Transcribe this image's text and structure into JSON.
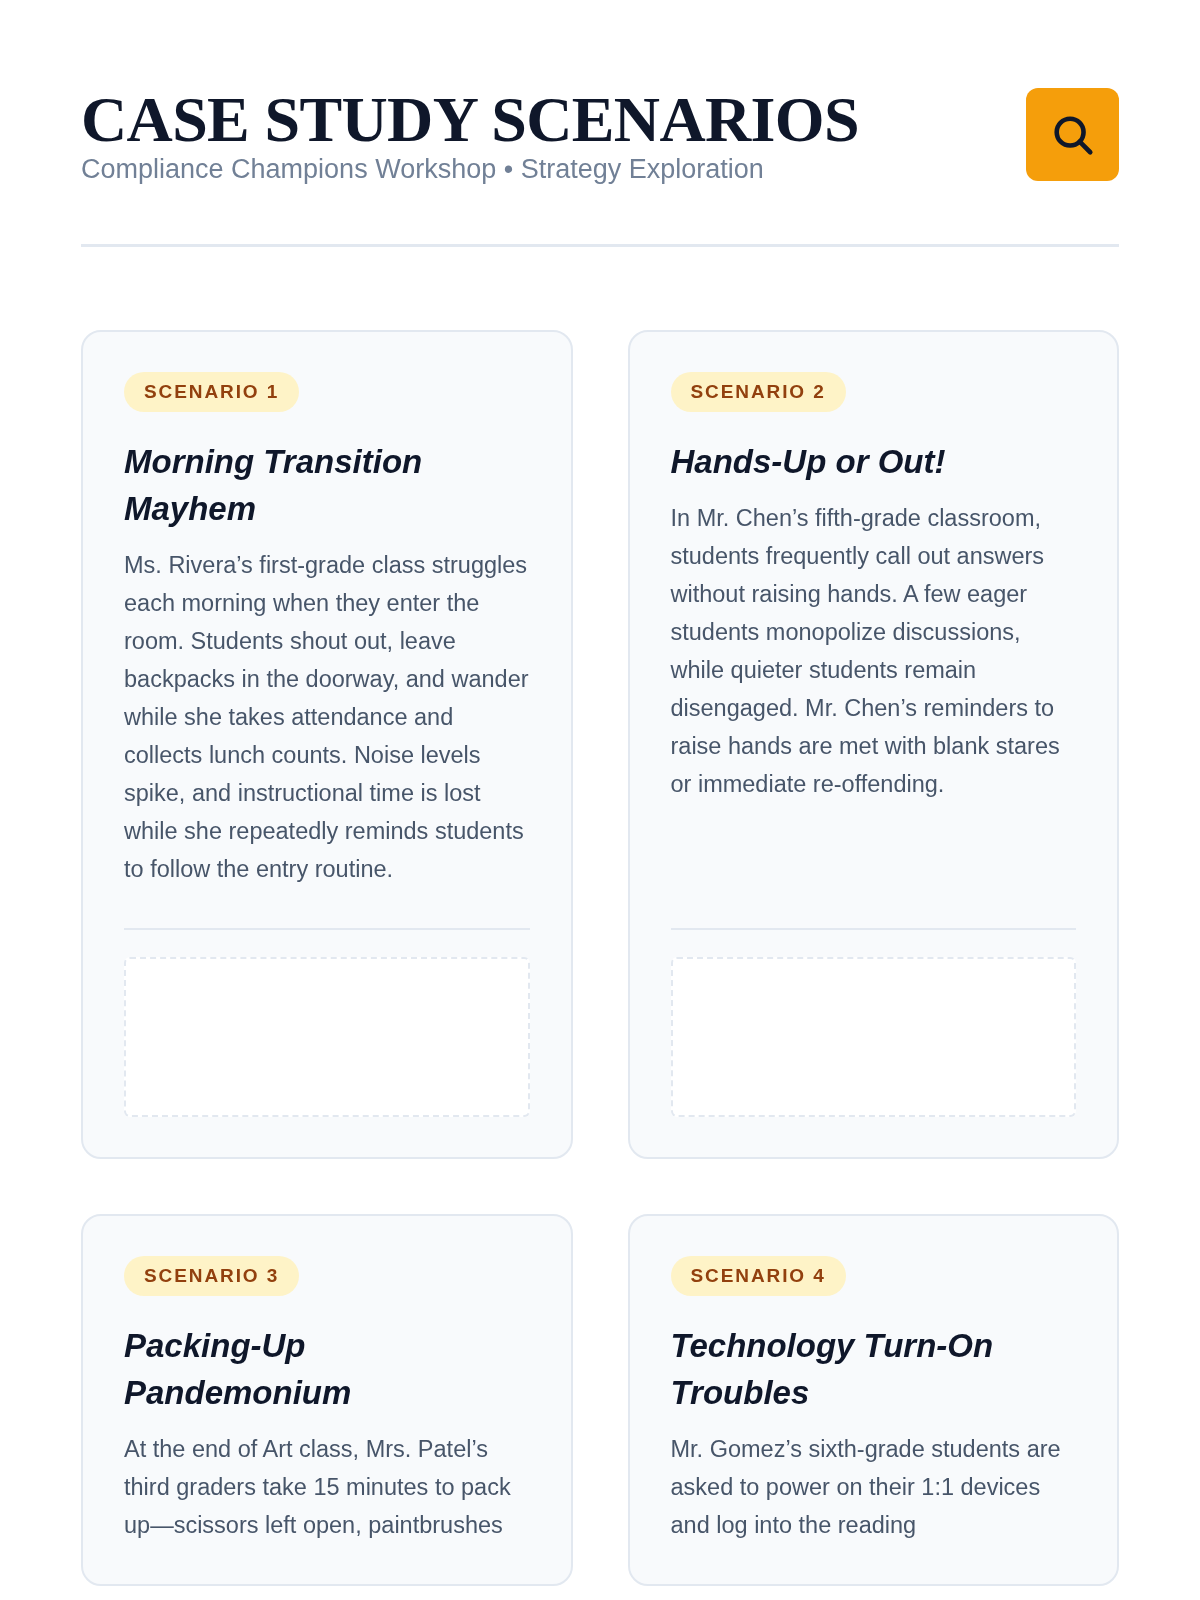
{
  "header": {
    "title": "CASE STUDY SCENARIOS",
    "subtitle": "Compliance Champions Workshop • Strategy Exploration"
  },
  "scenarios": [
    {
      "badge": "SCENARIO 1",
      "title": "Morning Transition Mayhem",
      "description": "Ms. Rivera’s first-grade class struggles each morning when they enter the room. Students shout out, leave backpacks in the doorway, and wander while she takes attendance and collects lunch counts. Noise levels spike, and instructional time is lost while she repeatedly reminds students to follow the entry routine.",
      "notes_area": true
    },
    {
      "badge": "SCENARIO 2",
      "title": "Hands-Up or Out!",
      "description": "In Mr. Chen’s fifth-grade classroom, students frequently call out answers without raising hands. A few eager students monopolize discussions, while quieter students remain disengaged. Mr. Chen’s reminders to raise hands are met with blank stares or immediate re-offending.",
      "notes_area": true
    },
    {
      "badge": "SCENARIO 3",
      "title": "Packing-Up Pandemonium",
      "description": "At the end of Art class, Mrs. Patel’s third graders take 15 minutes to pack up—scissors left open, paintbrushes",
      "notes_area": false
    },
    {
      "badge": "SCENARIO 4",
      "title": "Technology Turn-On Troubles",
      "description": "Mr. Gomez’s sixth-grade students are asked to power on their 1:1 devices and log into the reading",
      "notes_area": false
    }
  ]
}
